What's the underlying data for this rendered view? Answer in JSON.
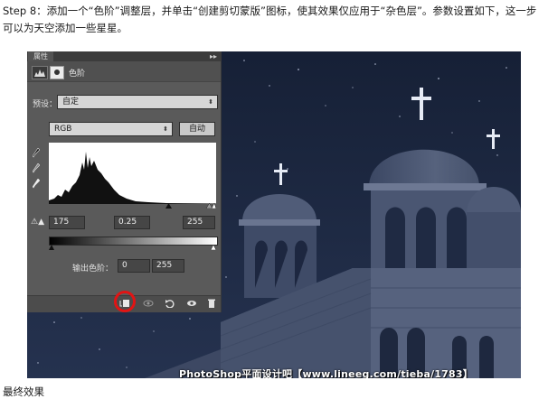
{
  "instruction_text": "Step 8：添加一个“色阶”调整层，并单击“创建剪切蒙版”图标，使其效果仅应用于“杂色层”。参数设置如下，这一步可以为天空添加一些星星。",
  "footer_text": "最终效果",
  "panel": {
    "tab_label": "属性",
    "collapse_glyph": "▸▸",
    "title": "色阶",
    "preset_label": "预设：",
    "preset_value": "自定",
    "channel_value": "RGB",
    "auto_button": "自动",
    "input_levels": {
      "black": "175",
      "gamma": "0.25",
      "white": "255"
    },
    "output_label": "输出色阶：",
    "output_levels": {
      "black": "0",
      "white": "255"
    },
    "toolbar_icons": [
      "clip-to-layer-icon",
      "view-previous-icon",
      "reset-icon",
      "visibility-eye-icon",
      "trash-icon"
    ]
  },
  "watermark": "PhotoShop平面设计吧【www.lineeg.com/tieba/1783】",
  "colors": {
    "highlight": "#e11414",
    "sky": "#1b2740",
    "panel": "#5a5a5a"
  }
}
